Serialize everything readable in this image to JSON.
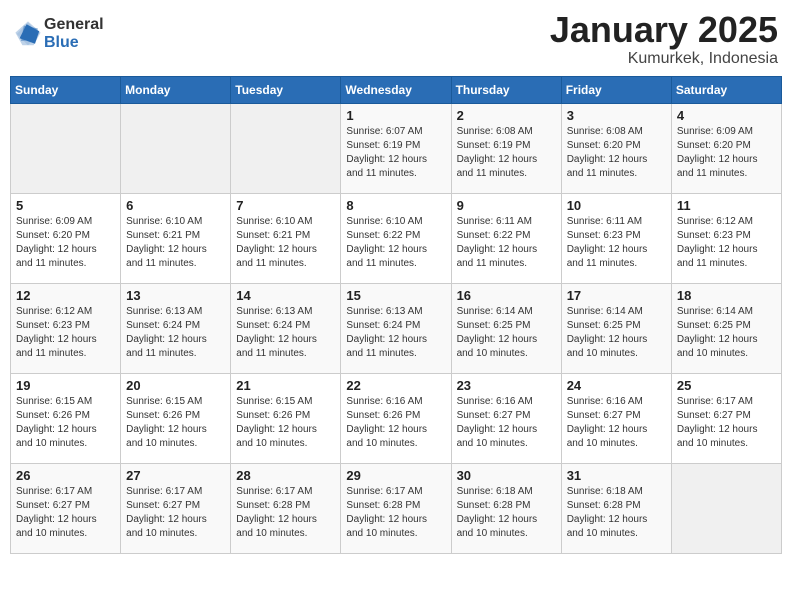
{
  "header": {
    "logo_general": "General",
    "logo_blue": "Blue",
    "month": "January 2025",
    "location": "Kumurkek, Indonesia"
  },
  "weekdays": [
    "Sunday",
    "Monday",
    "Tuesday",
    "Wednesday",
    "Thursday",
    "Friday",
    "Saturday"
  ],
  "weeks": [
    [
      {
        "day": "",
        "info": ""
      },
      {
        "day": "",
        "info": ""
      },
      {
        "day": "",
        "info": ""
      },
      {
        "day": "1",
        "info": "Sunrise: 6:07 AM\nSunset: 6:19 PM\nDaylight: 12 hours\nand 11 minutes."
      },
      {
        "day": "2",
        "info": "Sunrise: 6:08 AM\nSunset: 6:19 PM\nDaylight: 12 hours\nand 11 minutes."
      },
      {
        "day": "3",
        "info": "Sunrise: 6:08 AM\nSunset: 6:20 PM\nDaylight: 12 hours\nand 11 minutes."
      },
      {
        "day": "4",
        "info": "Sunrise: 6:09 AM\nSunset: 6:20 PM\nDaylight: 12 hours\nand 11 minutes."
      }
    ],
    [
      {
        "day": "5",
        "info": "Sunrise: 6:09 AM\nSunset: 6:20 PM\nDaylight: 12 hours\nand 11 minutes."
      },
      {
        "day": "6",
        "info": "Sunrise: 6:10 AM\nSunset: 6:21 PM\nDaylight: 12 hours\nand 11 minutes."
      },
      {
        "day": "7",
        "info": "Sunrise: 6:10 AM\nSunset: 6:21 PM\nDaylight: 12 hours\nand 11 minutes."
      },
      {
        "day": "8",
        "info": "Sunrise: 6:10 AM\nSunset: 6:22 PM\nDaylight: 12 hours\nand 11 minutes."
      },
      {
        "day": "9",
        "info": "Sunrise: 6:11 AM\nSunset: 6:22 PM\nDaylight: 12 hours\nand 11 minutes."
      },
      {
        "day": "10",
        "info": "Sunrise: 6:11 AM\nSunset: 6:23 PM\nDaylight: 12 hours\nand 11 minutes."
      },
      {
        "day": "11",
        "info": "Sunrise: 6:12 AM\nSunset: 6:23 PM\nDaylight: 12 hours\nand 11 minutes."
      }
    ],
    [
      {
        "day": "12",
        "info": "Sunrise: 6:12 AM\nSunset: 6:23 PM\nDaylight: 12 hours\nand 11 minutes."
      },
      {
        "day": "13",
        "info": "Sunrise: 6:13 AM\nSunset: 6:24 PM\nDaylight: 12 hours\nand 11 minutes."
      },
      {
        "day": "14",
        "info": "Sunrise: 6:13 AM\nSunset: 6:24 PM\nDaylight: 12 hours\nand 11 minutes."
      },
      {
        "day": "15",
        "info": "Sunrise: 6:13 AM\nSunset: 6:24 PM\nDaylight: 12 hours\nand 11 minutes."
      },
      {
        "day": "16",
        "info": "Sunrise: 6:14 AM\nSunset: 6:25 PM\nDaylight: 12 hours\nand 10 minutes."
      },
      {
        "day": "17",
        "info": "Sunrise: 6:14 AM\nSunset: 6:25 PM\nDaylight: 12 hours\nand 10 minutes."
      },
      {
        "day": "18",
        "info": "Sunrise: 6:14 AM\nSunset: 6:25 PM\nDaylight: 12 hours\nand 10 minutes."
      }
    ],
    [
      {
        "day": "19",
        "info": "Sunrise: 6:15 AM\nSunset: 6:26 PM\nDaylight: 12 hours\nand 10 minutes."
      },
      {
        "day": "20",
        "info": "Sunrise: 6:15 AM\nSunset: 6:26 PM\nDaylight: 12 hours\nand 10 minutes."
      },
      {
        "day": "21",
        "info": "Sunrise: 6:15 AM\nSunset: 6:26 PM\nDaylight: 12 hours\nand 10 minutes."
      },
      {
        "day": "22",
        "info": "Sunrise: 6:16 AM\nSunset: 6:26 PM\nDaylight: 12 hours\nand 10 minutes."
      },
      {
        "day": "23",
        "info": "Sunrise: 6:16 AM\nSunset: 6:27 PM\nDaylight: 12 hours\nand 10 minutes."
      },
      {
        "day": "24",
        "info": "Sunrise: 6:16 AM\nSunset: 6:27 PM\nDaylight: 12 hours\nand 10 minutes."
      },
      {
        "day": "25",
        "info": "Sunrise: 6:17 AM\nSunset: 6:27 PM\nDaylight: 12 hours\nand 10 minutes."
      }
    ],
    [
      {
        "day": "26",
        "info": "Sunrise: 6:17 AM\nSunset: 6:27 PM\nDaylight: 12 hours\nand 10 minutes."
      },
      {
        "day": "27",
        "info": "Sunrise: 6:17 AM\nSunset: 6:27 PM\nDaylight: 12 hours\nand 10 minutes."
      },
      {
        "day": "28",
        "info": "Sunrise: 6:17 AM\nSunset: 6:28 PM\nDaylight: 12 hours\nand 10 minutes."
      },
      {
        "day": "29",
        "info": "Sunrise: 6:17 AM\nSunset: 6:28 PM\nDaylight: 12 hours\nand 10 minutes."
      },
      {
        "day": "30",
        "info": "Sunrise: 6:18 AM\nSunset: 6:28 PM\nDaylight: 12 hours\nand 10 minutes."
      },
      {
        "day": "31",
        "info": "Sunrise: 6:18 AM\nSunset: 6:28 PM\nDaylight: 12 hours\nand 10 minutes."
      },
      {
        "day": "",
        "info": ""
      }
    ]
  ]
}
